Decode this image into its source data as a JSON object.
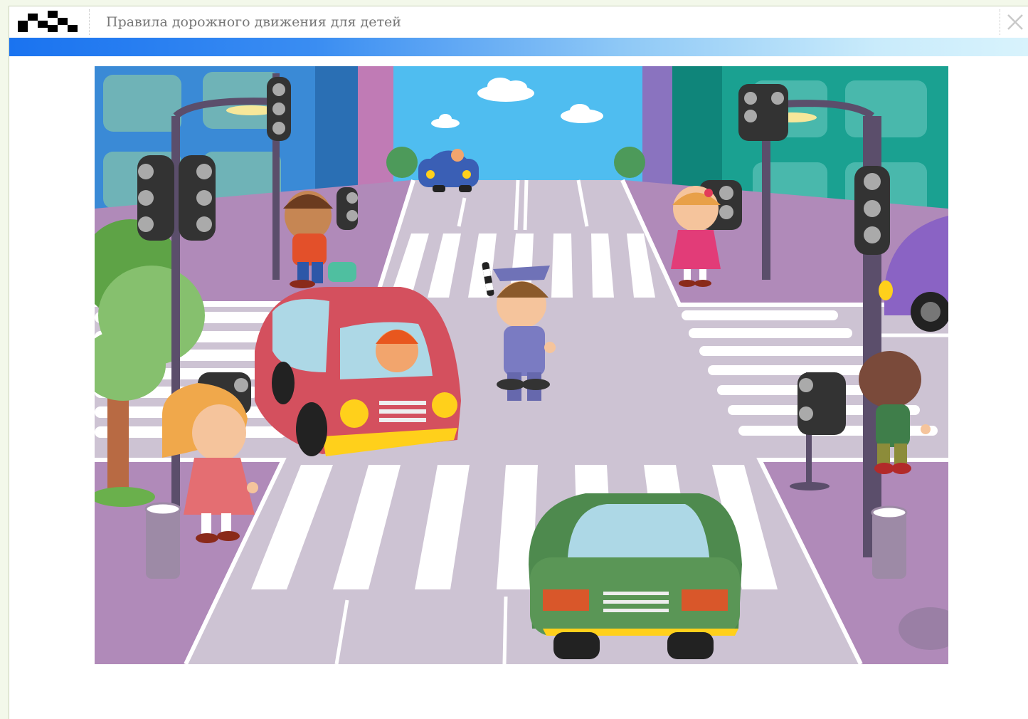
{
  "window": {
    "title": "Правила дорожного движения для детей",
    "close_icon": "close-icon",
    "logo_icon": "checkered-flag-icon"
  },
  "colors": {
    "accent_bar_start": "#1a73f0",
    "accent_bar_end": "#d8f3fc",
    "sky": "#4fbdf0",
    "road": "#cdc3d3",
    "sidewalk": "#b08ab9",
    "red_car": "#d4505e",
    "green_car": "#4e8a4e",
    "blue_car": "#3a5fb5",
    "purple_car": "#8a63c4"
  },
  "scene": {
    "description_icon": "traffic-intersection-illustration"
  }
}
